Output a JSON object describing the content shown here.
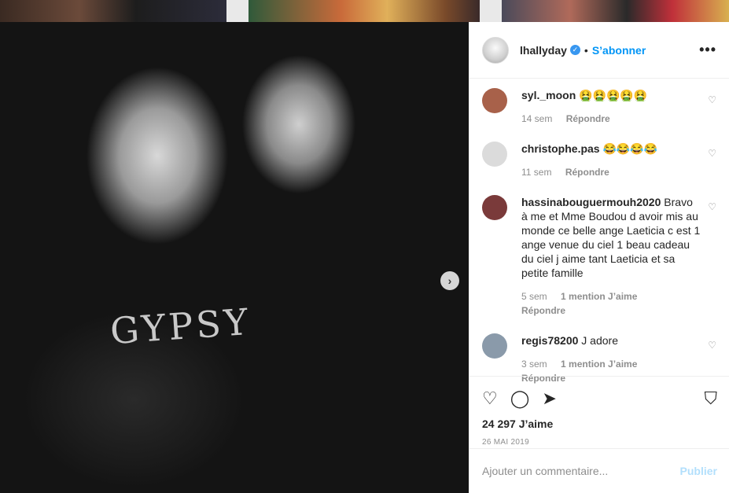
{
  "post": {
    "username": "lhallyday",
    "verified_icon": "verified-badge-icon",
    "dot": "•",
    "follow_label": "S’abonner",
    "more_label": "•••",
    "next_icon": "›"
  },
  "photo": {
    "shirt_text": "GYPSY"
  },
  "comments": [
    {
      "user": "syl._moon",
      "text": "🤮🤮🤮🤮🤮",
      "time": "14 sem",
      "likes": "",
      "reply": "Répondre",
      "avatar_color": "#a8614a"
    },
    {
      "user": "christophe.pas",
      "text": "😂😂😂😂",
      "time": "11 sem",
      "likes": "",
      "reply": "Répondre",
      "avatar_color": "#dbdbdb"
    },
    {
      "user": "hassinabouguermouh2020",
      "text": "Bravo à me et Mme Boudou d avoir mis au monde ce belle ange Laeticia c est 1 ange venue du ciel 1 beau cadeau du ciel j aime tant Laeticia et sa petite famille",
      "time": "5 sem",
      "likes": "1 mention J’aime",
      "reply": "Répondre",
      "avatar_color": "#7a3a3a"
    },
    {
      "user": "regis78200",
      "text": "J adore",
      "time": "3 sem",
      "likes": "1 mention J’aime",
      "reply": "Répondre",
      "avatar_color": "#8a9aaa"
    }
  ],
  "actions": {
    "like_icon": "♡",
    "comment_icon": "◯",
    "share_icon": "➤",
    "bookmark_icon": "⛉",
    "likes_text": "24 297 J’aime",
    "date": "26 MAI 2019"
  },
  "add_comment": {
    "placeholder": "Ajouter un commentaire...",
    "publish_label": "Publier"
  }
}
